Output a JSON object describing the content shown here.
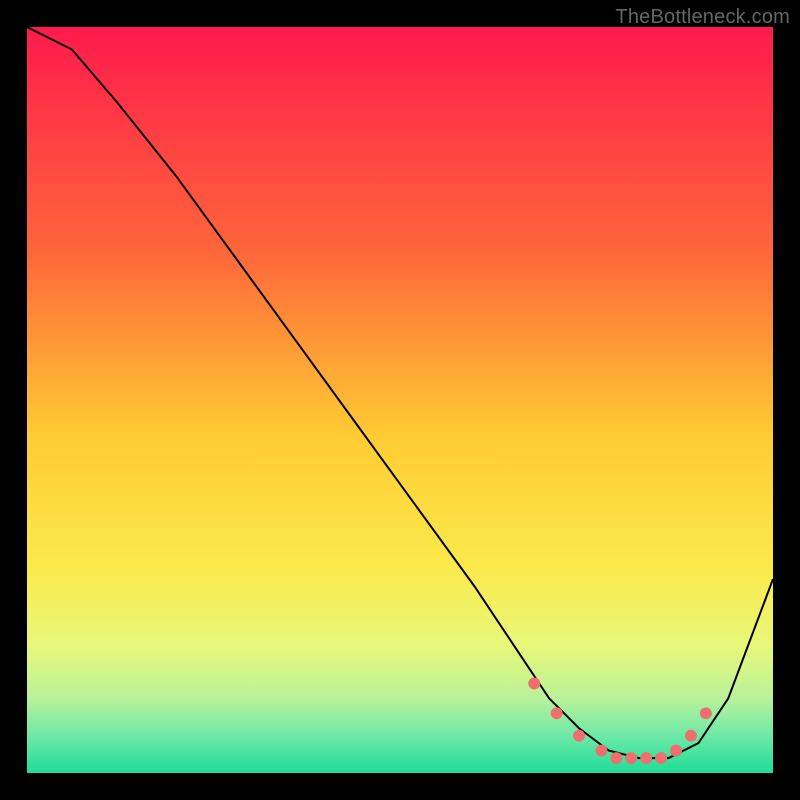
{
  "watermark": "TheBottleneck.com",
  "chart_data": {
    "type": "line",
    "title": "",
    "xlabel": "",
    "ylabel": "",
    "xlim": [
      0,
      100
    ],
    "ylim": [
      0,
      100
    ],
    "grid": false,
    "gradient_stops": [
      {
        "pct": 0,
        "color": "#ff1a4d"
      },
      {
        "pct": 30,
        "color": "#ff663a"
      },
      {
        "pct": 55,
        "color": "#ffcc33"
      },
      {
        "pct": 72,
        "color": "#fbe94a"
      },
      {
        "pct": 83,
        "color": "#e8f77a"
      },
      {
        "pct": 90,
        "color": "#b9f29a"
      },
      {
        "pct": 95,
        "color": "#6de9a7"
      },
      {
        "pct": 100,
        "color": "#1fdc98"
      }
    ],
    "series": [
      {
        "name": "bottleneck-curve",
        "color": "#000000",
        "x": [
          0,
          6,
          12,
          20,
          28,
          36,
          44,
          52,
          60,
          66,
          70,
          74,
          78,
          82,
          86,
          90,
          94,
          100
        ],
        "values": [
          100,
          97,
          90,
          80,
          69,
          58,
          47,
          36,
          25,
          16,
          10,
          6,
          3,
          2,
          2,
          4,
          10,
          26
        ]
      }
    ],
    "markers": {
      "name": "highlight-dots",
      "color": "#ef6f6f",
      "radius": 6,
      "x": [
        68,
        71,
        74,
        77,
        79,
        81,
        83,
        85,
        87,
        89,
        91
      ],
      "values": [
        12,
        8,
        5,
        3,
        2,
        2,
        2,
        2,
        3,
        5,
        8
      ]
    }
  }
}
